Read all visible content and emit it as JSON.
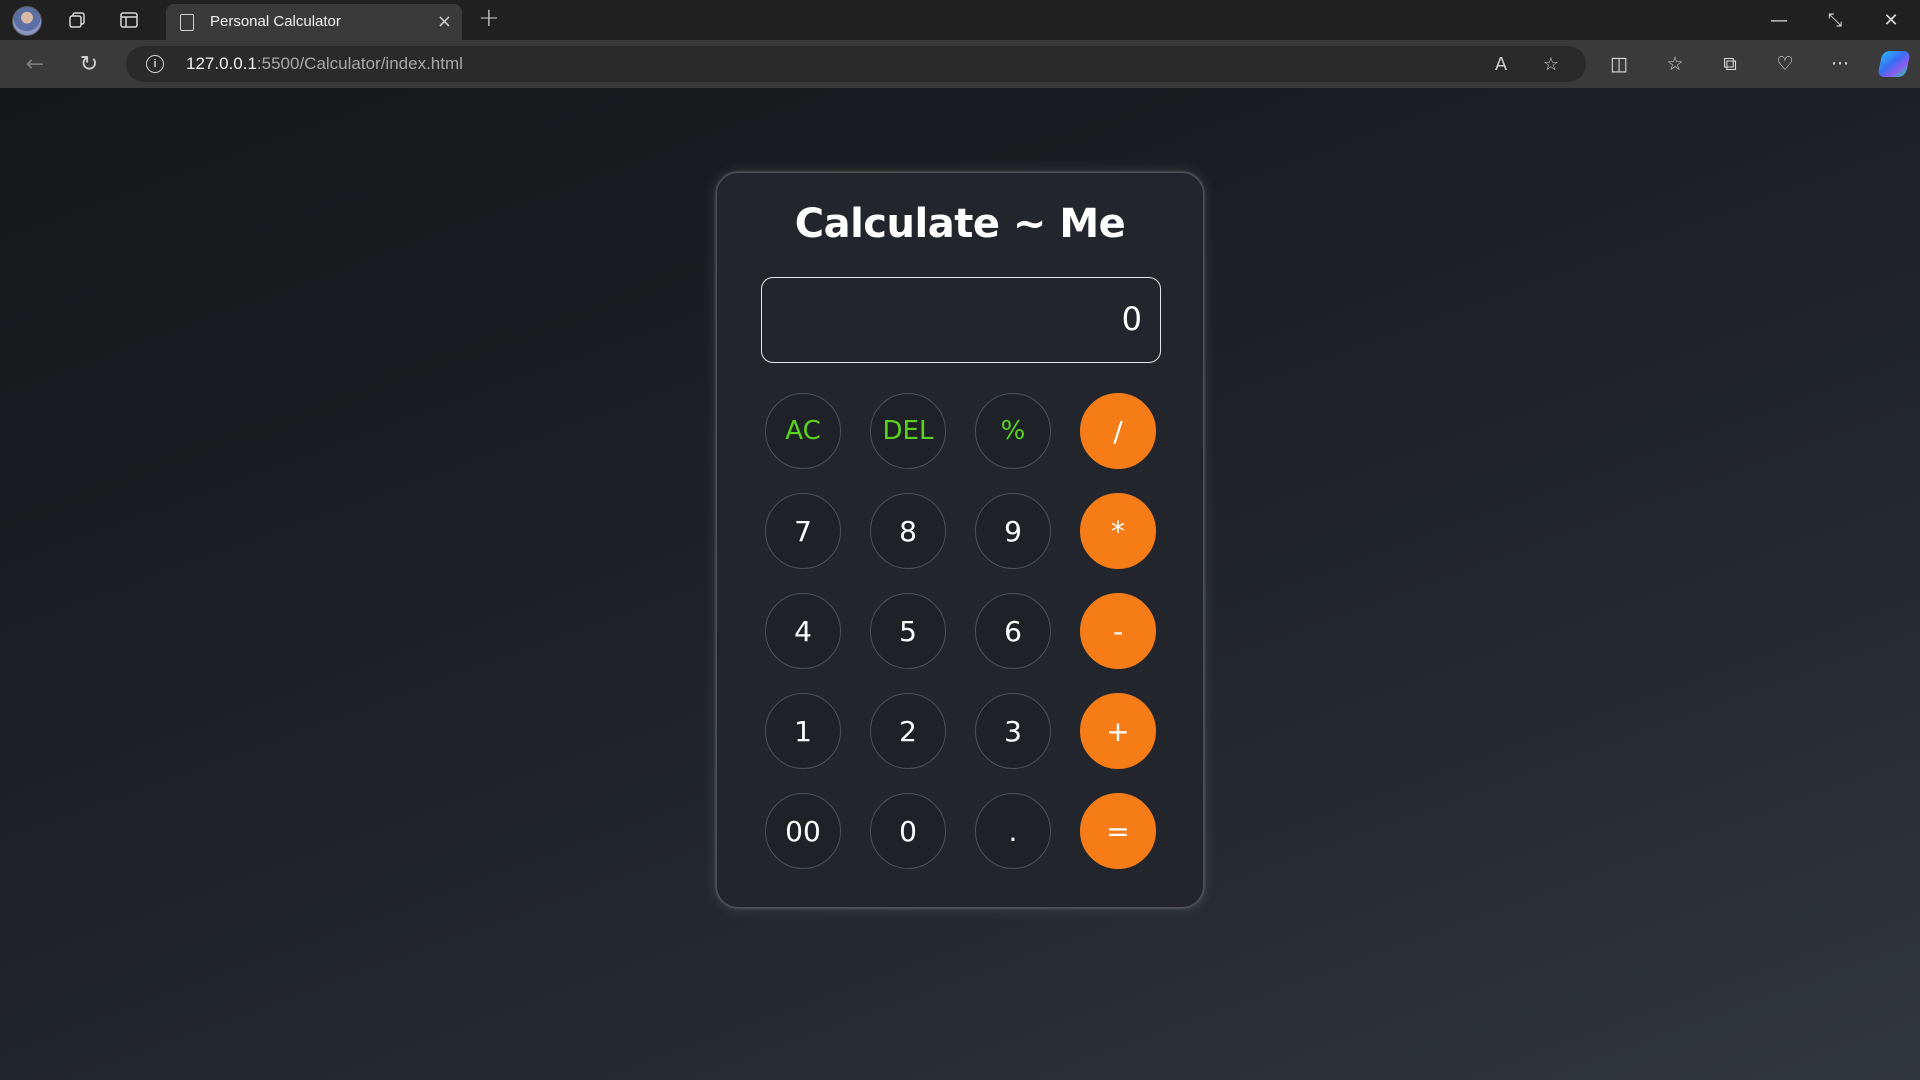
{
  "browser": {
    "tab_title": "Personal Calculator",
    "tab_close": "×",
    "new_tab": "+",
    "url_host": "127.0.0.1",
    "url_rest": ":5500/Calculator/index.html",
    "info_icon": "i",
    "icons": {
      "back": "←",
      "refresh": "↻",
      "read_aloud": "A",
      "favorite": "☆",
      "split_screen": "◫",
      "favorites": "☆",
      "collections": "⧉",
      "health": "♡",
      "more": "···",
      "minimize": "—",
      "restore": "⤡",
      "close": "✕"
    }
  },
  "calculator": {
    "title": "Calculate ~ Me",
    "display_value": "0",
    "keys": [
      {
        "label": "AC",
        "kind": "func"
      },
      {
        "label": "DEL",
        "kind": "func"
      },
      {
        "label": "%",
        "kind": "func"
      },
      {
        "label": "/",
        "kind": "op"
      },
      {
        "label": "7",
        "kind": "num"
      },
      {
        "label": "8",
        "kind": "num"
      },
      {
        "label": "9",
        "kind": "num"
      },
      {
        "label": "*",
        "kind": "op"
      },
      {
        "label": "4",
        "kind": "num"
      },
      {
        "label": "5",
        "kind": "num"
      },
      {
        "label": "6",
        "kind": "num"
      },
      {
        "label": "-",
        "kind": "op"
      },
      {
        "label": "1",
        "kind": "num"
      },
      {
        "label": "2",
        "kind": "num"
      },
      {
        "label": "3",
        "kind": "num"
      },
      {
        "label": "+",
        "kind": "op"
      },
      {
        "label": "00",
        "kind": "num"
      },
      {
        "label": "0",
        "kind": "num"
      },
      {
        "label": ".",
        "kind": "num"
      },
      {
        "label": "=",
        "kind": "op"
      }
    ]
  },
  "colors": {
    "accent_orange": "#f57c16",
    "function_green": "#58d31e",
    "panel": "#22262c"
  }
}
